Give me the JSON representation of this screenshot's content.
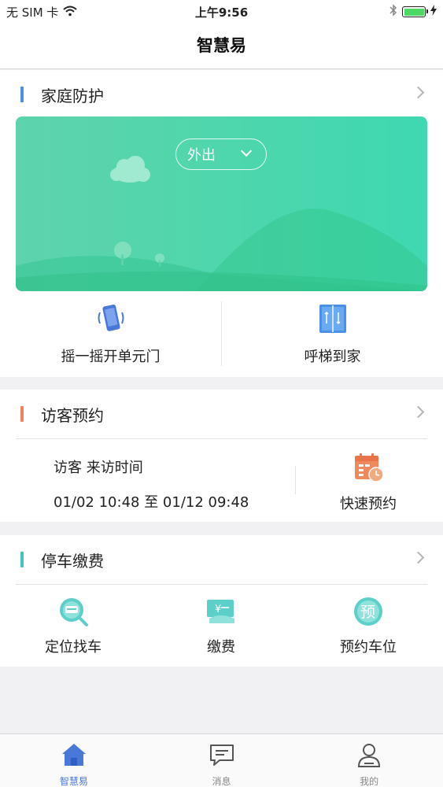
{
  "status_bar": {
    "carrier": "无 SIM 卡",
    "time": "上午9:56"
  },
  "nav": {
    "title": "智慧易"
  },
  "home_protection": {
    "title": "家庭防护",
    "mode": "外出",
    "actions": [
      {
        "label": "摇一摇开单元门",
        "icon": "phone-shake-icon"
      },
      {
        "label": "呼梯到家",
        "icon": "elevator-icon"
      }
    ]
  },
  "visitor": {
    "title": "访客预约",
    "line1": "访客 来访时间",
    "line2": "01/02 10:48 至 01/12 09:48",
    "quick_label": "快速预约",
    "quick_icon": "calendar-clock-icon"
  },
  "parking": {
    "title": "停车缴费",
    "items": [
      {
        "label": "定位找车",
        "icon": "car-search-icon"
      },
      {
        "label": "缴费",
        "icon": "payment-icon"
      },
      {
        "label": "预约车位",
        "icon": "reserve-icon"
      }
    ]
  },
  "tabs": [
    {
      "label": "智慧易",
      "icon": "home-icon",
      "active": true
    },
    {
      "label": "消息",
      "icon": "chat-icon",
      "active": false
    },
    {
      "label": "我的",
      "icon": "user-icon",
      "active": false
    }
  ],
  "colors": {
    "accent_blue": "#4a78d8",
    "bar_home": "#4a8fe0",
    "bar_visitor": "#f08060",
    "bar_parking": "#40c4c0",
    "banner_green": "#4fd6ac"
  }
}
